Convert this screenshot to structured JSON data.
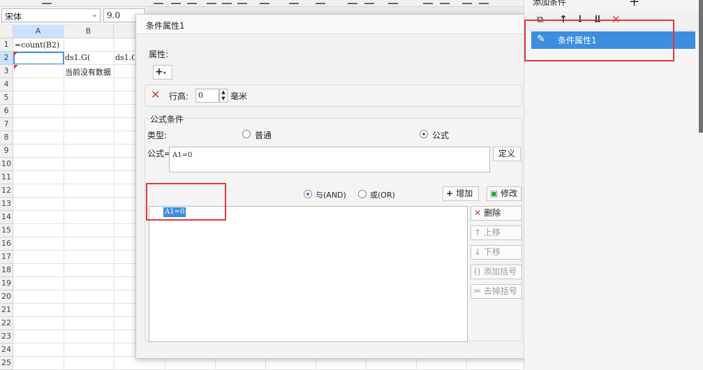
{
  "toolbar": {
    "font_name": "宋体",
    "font_size": "9.0"
  },
  "sheet": {
    "columns": [
      "A",
      "B"
    ],
    "rows": [
      "1",
      "2",
      "3",
      "4",
      "5",
      "6",
      "7",
      "8",
      "9",
      "10",
      "11",
      "12",
      "13",
      "14",
      "15",
      "16",
      "17",
      "18",
      "19",
      "20",
      "21",
      "22",
      "23",
      "24",
      "25"
    ],
    "cells": {
      "A1": "=count(B2)",
      "B2": "ds1.G(",
      "C2": "ds1.G",
      "B3": "当前没有数据"
    }
  },
  "dialog": {
    "title": "条件属性1",
    "attr_label": "属性:",
    "add_icon": "plus-icon",
    "row_height_label": "行高:",
    "row_height_value": "0",
    "row_height_unit": "毫米",
    "formula_section_label": "公式条件",
    "type_label": "类型:",
    "type_normal": "普通",
    "type_formula": "公式",
    "formula_label": "公式=",
    "formula_value": "A1=0",
    "define_button": "定义",
    "and_label": "与(AND)",
    "or_label": "或(OR)",
    "add_button": "增加",
    "modify_button": "修改",
    "delete_button": "删除",
    "up_button": "上移",
    "down_button": "下移",
    "add_bracket_button": "添加括号",
    "remove_bracket_button": "去掉括号",
    "condition_items": [
      "A1=0"
    ]
  },
  "right_panel": {
    "title": "添加条件",
    "items": [
      "条件属性1"
    ]
  },
  "colors": {
    "accent": "#3d8ee0",
    "highlight": "#e0383a",
    "selection": "#4b8ee8"
  }
}
